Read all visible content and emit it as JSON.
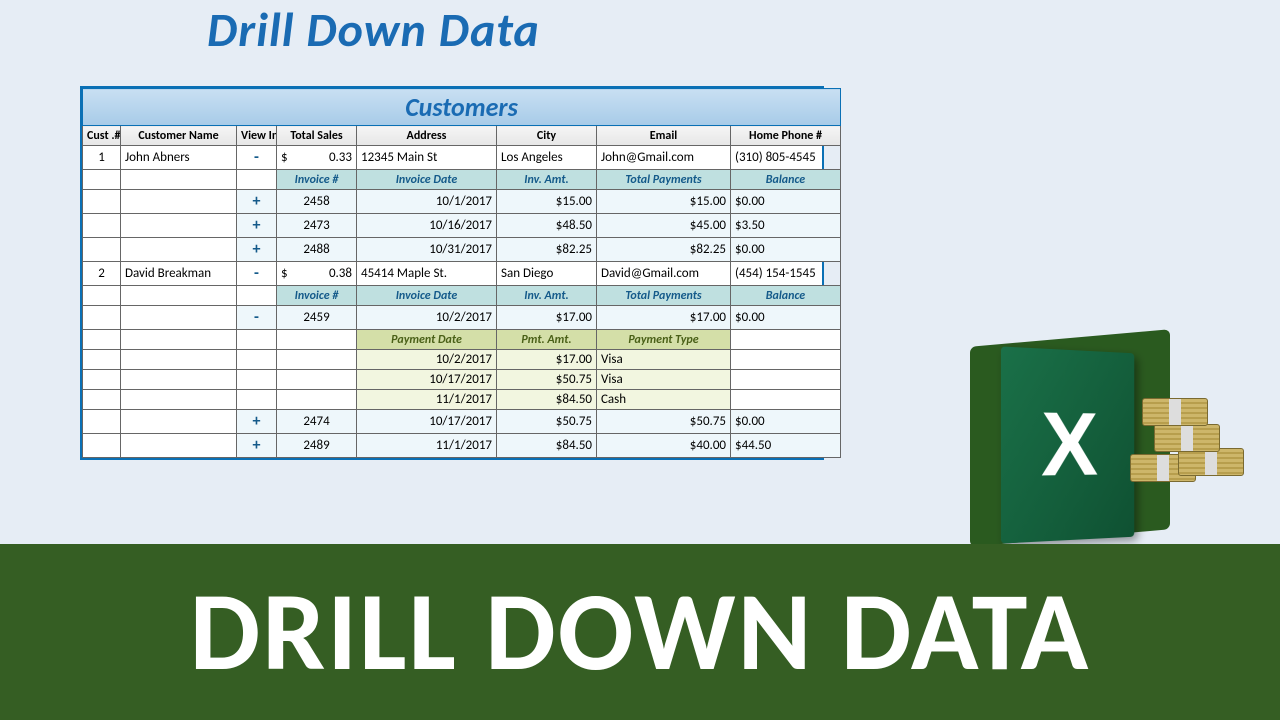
{
  "titles": {
    "top": "Drill Down Data",
    "table": "Customers",
    "bottom": "DRILL DOWN DATA"
  },
  "cols": {
    "id": "Cust .#",
    "name": "Customer Name",
    "view": "View Inv.",
    "total": "Total Sales",
    "addr": "Address",
    "city": "City",
    "email": "Email",
    "phone": "Home Phone #"
  },
  "inv_cols": {
    "num": "Invoice #",
    "date": "Invoice Date",
    "amt": "Inv. Amt.",
    "pay": "Total Payments",
    "bal": "Balance"
  },
  "pay_cols": {
    "date": "Payment Date",
    "amt": "Pmt. Amt.",
    "type": "Payment Type"
  },
  "customers": [
    {
      "id": "1",
      "name": "John Abners",
      "toggle": "-",
      "currency": "$",
      "total": "0.33",
      "addr": "12345 Main St",
      "city": "Los Angeles",
      "email": "John@Gmail.com",
      "phone": "(310) 805-4545",
      "invoices": [
        {
          "toggle": "+",
          "num": "2458",
          "date": "10/1/2017",
          "amt": "$15.00",
          "pay": "$15.00",
          "bal": "$0.00"
        },
        {
          "toggle": "+",
          "num": "2473",
          "date": "10/16/2017",
          "amt": "$48.50",
          "pay": "$45.00",
          "bal": "$3.50"
        },
        {
          "toggle": "+",
          "num": "2488",
          "date": "10/31/2017",
          "amt": "$82.25",
          "pay": "$82.25",
          "bal": "$0.00"
        }
      ]
    },
    {
      "id": "2",
      "name": "David Breakman",
      "toggle": "-",
      "currency": "$",
      "total": "0.38",
      "addr": "45414 Maple St.",
      "city": "San Diego",
      "email": "David@Gmail.com",
      "phone": "(454) 154-1545",
      "invoices_open": {
        "toggle": "-",
        "num": "2459",
        "date": "10/2/2017",
        "amt": "$17.00",
        "pay": "$17.00",
        "bal": "$0.00",
        "payments": [
          {
            "date": "10/2/2017",
            "amt": "$17.00",
            "type": "Visa"
          },
          {
            "date": "10/17/2017",
            "amt": "$50.75",
            "type": "Visa"
          },
          {
            "date": "11/1/2017",
            "amt": "$84.50",
            "type": "Cash"
          }
        ]
      },
      "invoices_closed": [
        {
          "toggle": "+",
          "num": "2474",
          "date": "10/17/2017",
          "amt": "$50.75",
          "pay": "$50.75",
          "bal": "$0.00"
        },
        {
          "toggle": "+",
          "num": "2489",
          "date": "11/1/2017",
          "amt": "$84.50",
          "pay": "$40.00",
          "bal": "$44.50"
        }
      ]
    }
  ]
}
